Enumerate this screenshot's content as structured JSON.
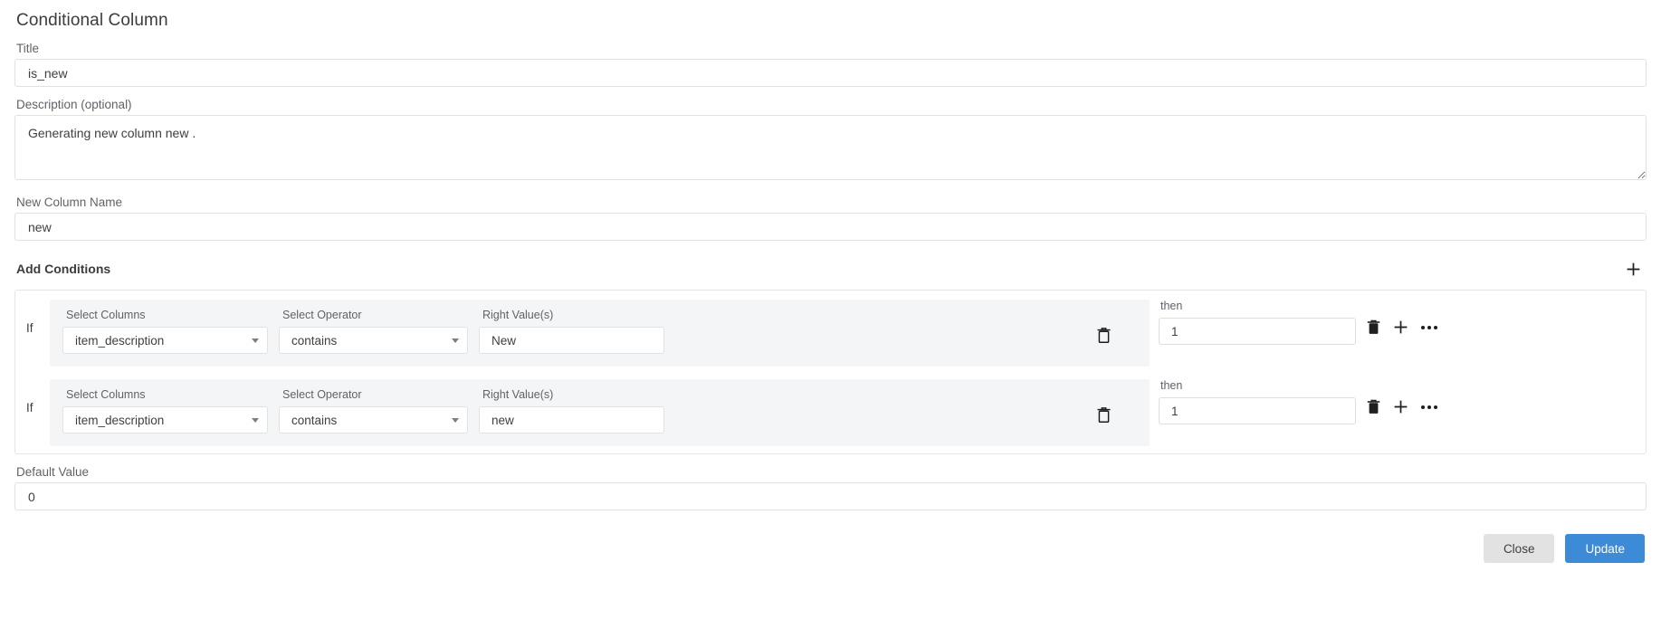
{
  "dialog": {
    "title": "Conditional Column"
  },
  "fields": {
    "title": {
      "label": "Title",
      "value": "is_new",
      "placeholder": ""
    },
    "description": {
      "label": "Description (optional)",
      "value": "Generating new column new .",
      "placeholder": ""
    },
    "new_column_name": {
      "label": "New Column Name",
      "value": "new",
      "placeholder": ""
    },
    "default_value": {
      "label": "Default Value",
      "value": "0",
      "placeholder": ""
    }
  },
  "conditions_section": {
    "title": "Add Conditions",
    "add_icon": "plus-icon",
    "column_headers": {
      "select_columns": "Select Columns",
      "select_operator": "Select Operator",
      "right_values": "Right Value(s)",
      "then": "then"
    },
    "if_label": "If",
    "rows": [
      {
        "if_label": "If",
        "column": "item_description",
        "operator": "contains",
        "right_value": "New",
        "then_value": "1",
        "delete_icon": "trash-outline-icon",
        "row_delete_icon": "trash-filled-icon",
        "row_add_icon": "plus-icon",
        "row_more_icon": "ellipsis-icon"
      },
      {
        "if_label": "If",
        "column": "item_description",
        "operator": "contains",
        "right_value": "new",
        "then_value": "1",
        "delete_icon": "trash-outline-icon",
        "row_delete_icon": "trash-filled-icon",
        "row_add_icon": "plus-icon",
        "row_more_icon": "ellipsis-icon"
      }
    ]
  },
  "footer": {
    "close_label": "Close",
    "update_label": "Update"
  },
  "colors": {
    "accent": "#3d8ad7",
    "panel": "#f4f5f7",
    "border": "#dfe1e5",
    "text": "#3c4043",
    "muted": "#5f6368",
    "close_button": "#e2e2e2"
  }
}
